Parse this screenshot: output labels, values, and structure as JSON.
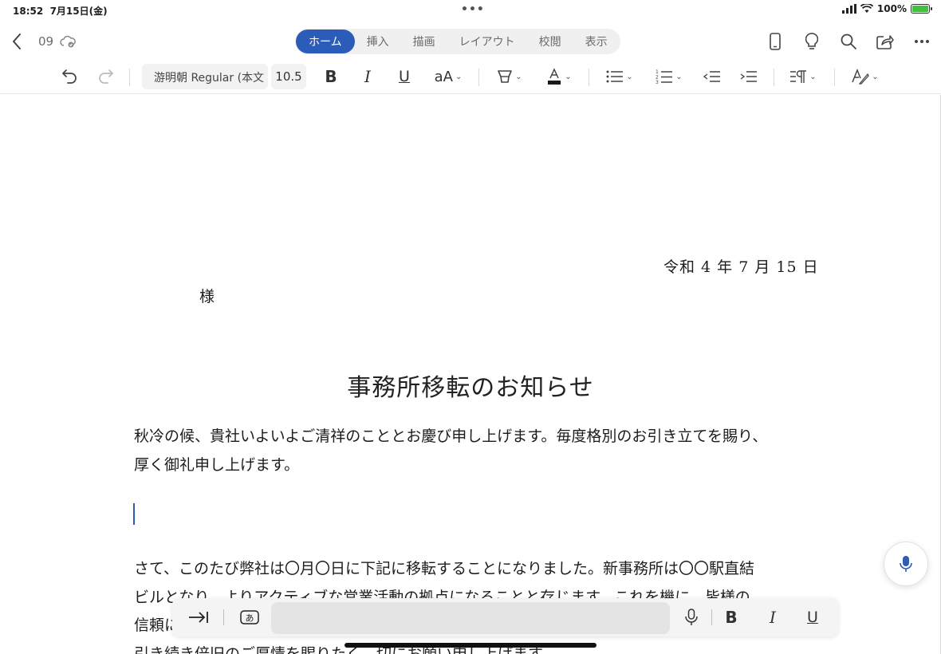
{
  "status_bar": {
    "time": "18:52",
    "date": "7月15日(金)",
    "battery": "100%"
  },
  "top_bar": {
    "doc_name": "09",
    "tabs": [
      "ホーム",
      "挿入",
      "描画",
      "レイアウト",
      "校閲",
      "表示"
    ],
    "active_tab": "ホーム"
  },
  "toolbar": {
    "font_name": "游明朝 Regular (本文",
    "font_size": "10.5",
    "font_color": "#1a1a1a"
  },
  "document": {
    "date": "令和 4 年 7 月 15 日",
    "addressee": "様",
    "title": "事務所移転のお知らせ",
    "para1": "秋冷の候、貴社いよいよご清祥のこととお慶び申し上げます。毎度格別のお引き立てを賜り、\n厚く御礼申し上げます。",
    "para2": "さて、このたび弊社は〇月〇日に下記に移転することになりました。新事務所は〇〇駅直結\nビルとなり、よりアクティブな営業活動の拠点になることと存じます。これを機に、皆様の\n信頼にお応えできるよう倍旧の努力をしてまいる所存でございます。\n引き続き倍旧のご厚情を賜りたく、切にお願い申し上げます。"
  },
  "colors": {
    "accent": "#2b5cb9"
  }
}
